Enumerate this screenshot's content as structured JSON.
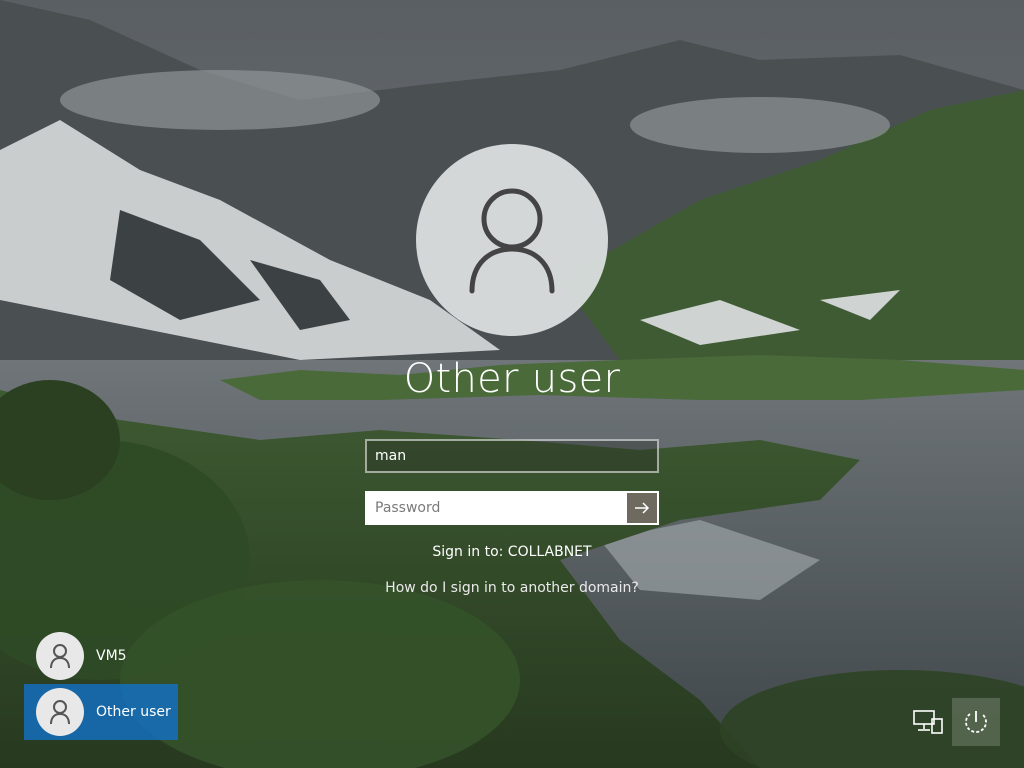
{
  "user": {
    "display_name": "Other user",
    "username_value": "man",
    "password_placeholder": "Password"
  },
  "signin": {
    "domain_text": "Sign in to: COLLABNET",
    "help_link": "How do I sign in to another domain?"
  },
  "user_list": [
    {
      "name": "VM5",
      "selected": false
    },
    {
      "name": "Other user",
      "selected": true
    }
  ],
  "icons": {
    "avatar": "user-silhouette-icon",
    "submit": "arrow-right-icon",
    "network": "network-icon",
    "power": "power-icon"
  },
  "colors": {
    "selected_user": "#146ebe",
    "submit_button": "#6f6a60",
    "avatar_circle": "#e2e5e7"
  }
}
